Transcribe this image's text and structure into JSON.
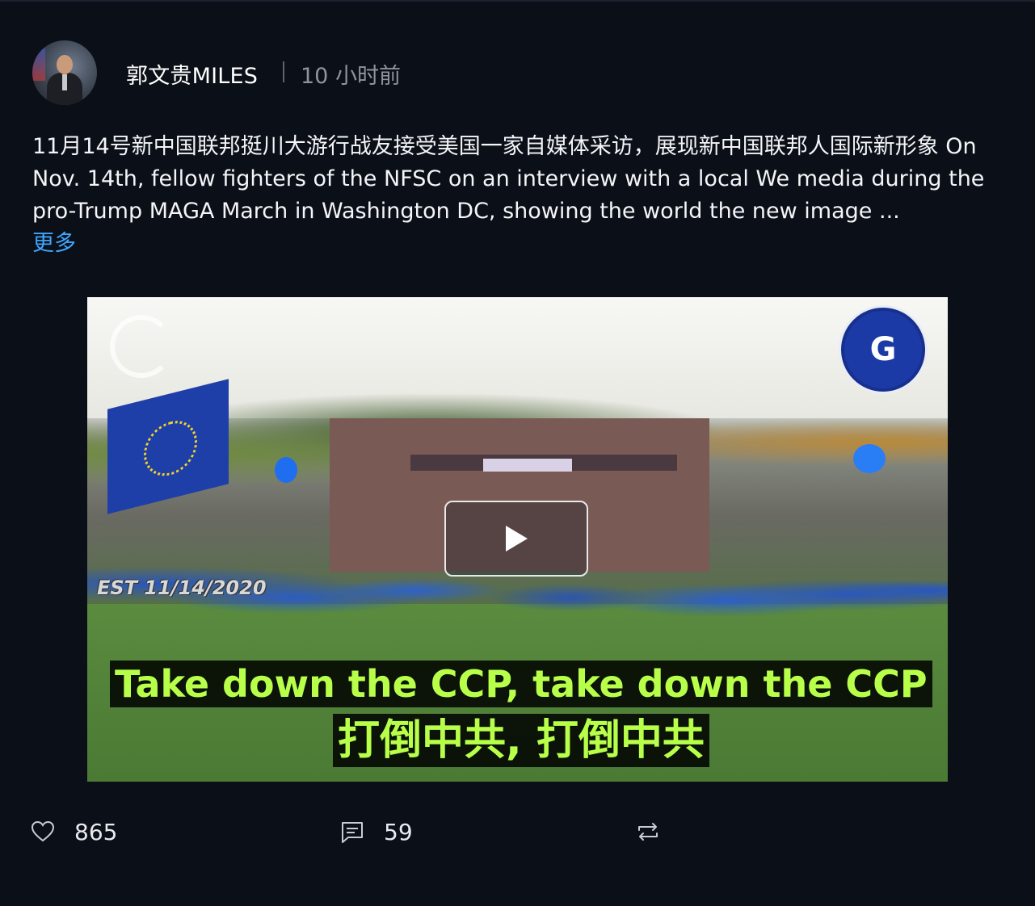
{
  "post": {
    "author": "郭文贵MILES",
    "separator": "|",
    "time": "10 小时前",
    "content": "11月14号新中国联邦挺川大游行战友接受美国一家自媒体采访，展现新中国联邦人国际新形象 On Nov. 14th, fellow fighters of the NFSC on an interview with a local We media during the pro-Trump MAGA March in Washington DC, showing the world the new image ...",
    "more_label": "更多"
  },
  "video": {
    "date_stamp": "EST 11/14/2020",
    "caption_en": "Take down the CCP, take down the CCP",
    "caption_zh": "打倒中共, 打倒中共",
    "badge_letter": "G",
    "play_icon": "play-icon"
  },
  "actions": {
    "likes": "865",
    "comments": "59",
    "like_icon": "heart-icon",
    "comment_icon": "comment-icon",
    "repost_icon": "repost-icon"
  },
  "colors": {
    "background": "#0b0f18",
    "link": "#3ea7ff",
    "caption": "#b8ff4a",
    "muted": "#8e939c"
  }
}
